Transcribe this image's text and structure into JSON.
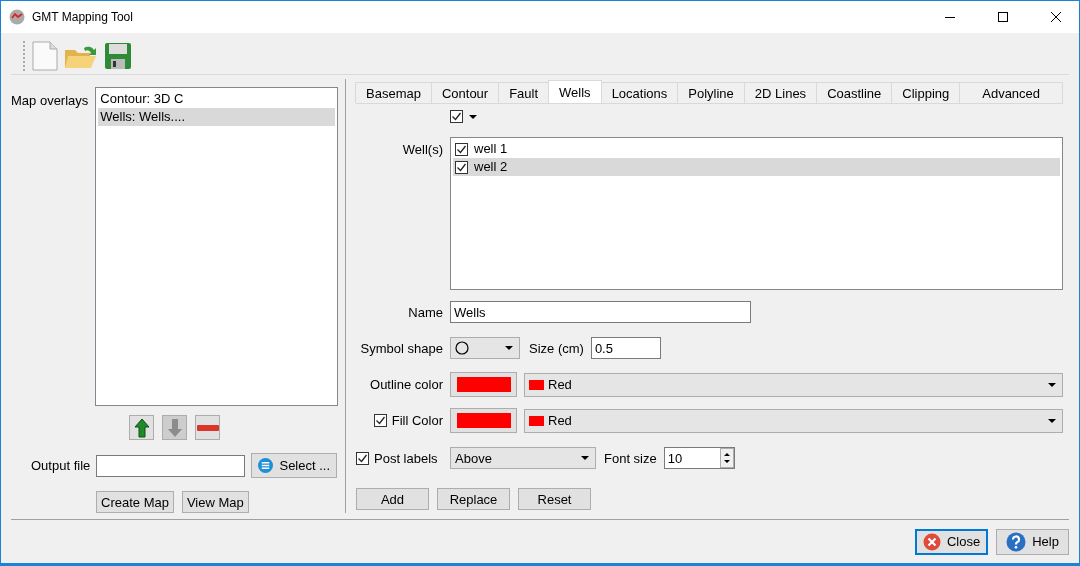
{
  "window": {
    "title": "GMT Mapping Tool"
  },
  "overlays": {
    "label": "Map overlays",
    "items": [
      {
        "label": "Contour: 3D C",
        "selected": false
      },
      {
        "label": "Wells: Wells....",
        "selected": true
      }
    ]
  },
  "output": {
    "label": "Output file",
    "select_button": "Select ..."
  },
  "left_buttons": [
    "Create Map",
    "View Map"
  ],
  "tabs": [
    {
      "label": "Basemap",
      "selected": false
    },
    {
      "label": "Contour",
      "selected": false
    },
    {
      "label": "Fault",
      "selected": false
    },
    {
      "label": "Wells",
      "selected": true
    },
    {
      "label": "Locations",
      "selected": false
    },
    {
      "label": "Polyline",
      "selected": false
    },
    {
      "label": "2D Lines",
      "selected": false
    },
    {
      "label": "Coastline",
      "selected": false
    },
    {
      "label": "Clipping",
      "selected": false
    },
    {
      "label": "Advanced",
      "selected": false
    }
  ],
  "select_all": {
    "checked": true
  },
  "wells": {
    "label": "Well(s)",
    "items": [
      {
        "label": "well 1",
        "checked": true,
        "selected": false
      },
      {
        "label": "well 2",
        "checked": true,
        "selected": true
      }
    ]
  },
  "name": {
    "label": "Name",
    "value": "Wells"
  },
  "symbol": {
    "label": "Symbol shape",
    "size_label": "Size (cm)",
    "size_value": "0.5"
  },
  "outline": {
    "label": "Outline color",
    "color": "#ff0000",
    "value": "Red"
  },
  "fill": {
    "label": "Fill Color",
    "checked": true,
    "color": "#ff0000",
    "value": "Red"
  },
  "post_labels": {
    "label": "Post labels",
    "checked": true,
    "value": "Above",
    "font_size_label": "Font size",
    "font_size": "10"
  },
  "form_buttons": [
    "Add",
    "Replace",
    "Reset"
  ],
  "footer_buttons": [
    {
      "kind": "close",
      "label": "Close"
    },
    {
      "kind": "help",
      "label": "Help"
    }
  ]
}
